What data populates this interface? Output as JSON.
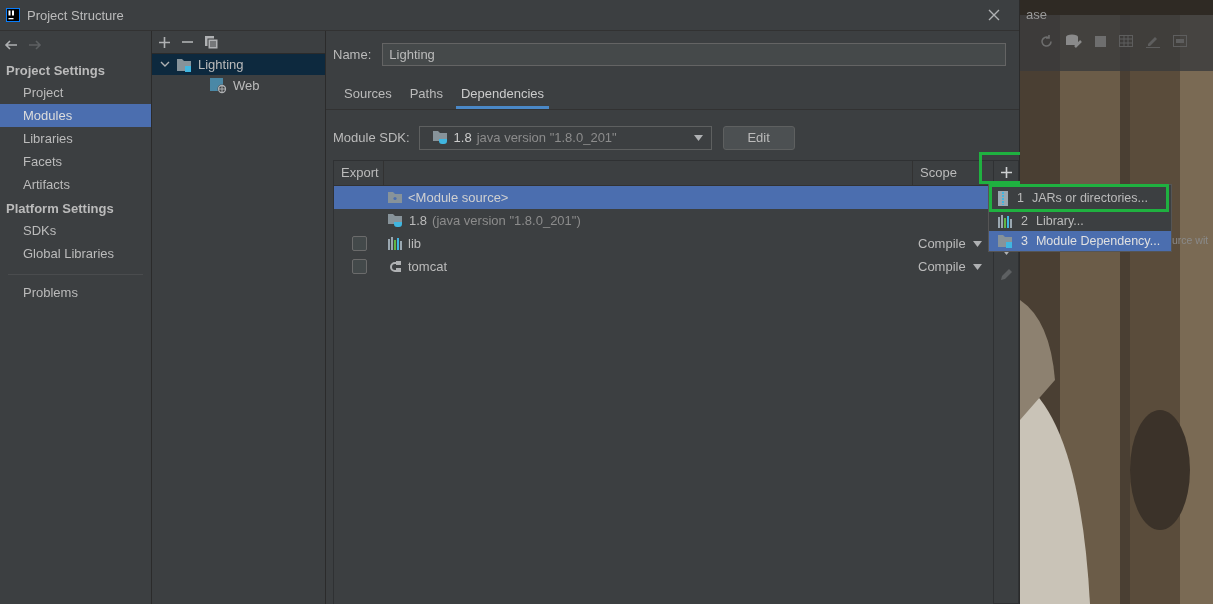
{
  "window": {
    "title": "Project Structure"
  },
  "nav": {
    "sections": [
      {
        "heading": "Project Settings",
        "items": [
          {
            "label": "Project",
            "selected": false
          },
          {
            "label": "Modules",
            "selected": true
          },
          {
            "label": "Libraries",
            "selected": false
          },
          {
            "label": "Facets",
            "selected": false
          },
          {
            "label": "Artifacts",
            "selected": false
          }
        ]
      },
      {
        "heading": "Platform Settings",
        "items": [
          {
            "label": "SDKs",
            "selected": false
          },
          {
            "label": "Global Libraries",
            "selected": false
          }
        ]
      }
    ],
    "extra_items": [
      {
        "label": "Problems",
        "selected": false
      }
    ]
  },
  "tree": [
    {
      "label": "Lighting",
      "kind": "module",
      "expanded": true,
      "selected": true,
      "children": [
        {
          "label": "Web",
          "kind": "facet",
          "selected": false
        }
      ]
    }
  ],
  "name_field": {
    "label": "Name:",
    "value": "Lighting"
  },
  "tabs": [
    {
      "label": "Sources",
      "selected": false
    },
    {
      "label": "Paths",
      "selected": false
    },
    {
      "label": "Dependencies",
      "selected": true
    }
  ],
  "module_sdk": {
    "label": "Module SDK:",
    "version": "1.8",
    "detail": "java version \"1.8.0_201\""
  },
  "edit_button": "Edit",
  "dependencies": {
    "columns": [
      "Export",
      "Scope"
    ],
    "add_button_marked": true,
    "rows": [
      {
        "kind": "module-source",
        "name": "<Module source>",
        "selected": true
      },
      {
        "kind": "sdk",
        "name": "1.8",
        "detail": "(java version \"1.8.0_201\")",
        "selected": false
      },
      {
        "kind": "library",
        "name": "lib",
        "exported": false,
        "scope": "Compile",
        "selected": false
      },
      {
        "kind": "server",
        "name": "tomcat",
        "exported": false,
        "scope": "Compile",
        "selected": false
      }
    ]
  },
  "add_menu": [
    {
      "number": "1",
      "label": "JARs or directories...",
      "kind": "jar",
      "selected": false,
      "marked": true
    },
    {
      "number": "2",
      "label": "Library...",
      "kind": "library",
      "selected": false,
      "marked": false
    },
    {
      "number": "3",
      "label": "Module Dependency...",
      "kind": "module",
      "selected": true,
      "marked": false
    }
  ],
  "background_ide": {
    "title_fragment": "ase",
    "hint_fragment": "urce wit"
  }
}
